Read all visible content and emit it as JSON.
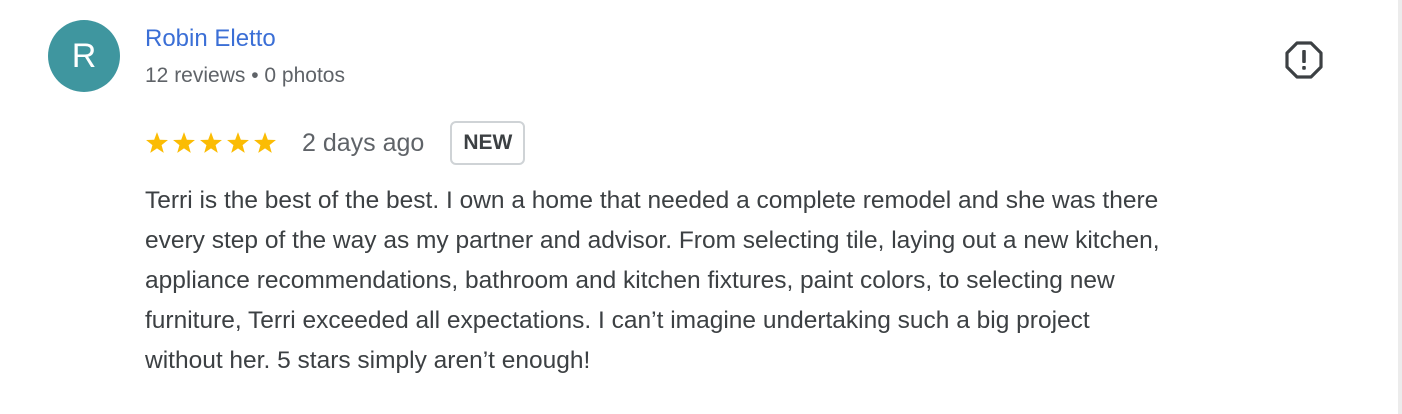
{
  "reviewer": {
    "initial": "R",
    "name": "Robin Eletto",
    "meta": "12 reviews • 0 photos",
    "avatar_color": "#3f969f"
  },
  "review": {
    "rating": 5,
    "rating_max": 5,
    "star_color": "#fbbc04",
    "date": "2 days ago",
    "badge": "NEW",
    "lines": [
      "Terri is the best of the best. I own a home that needed a complete remodel and she was there",
      "every step of the way as my partner and advisor. From selecting tile, laying out a new kitchen,",
      "appliance recommendations, bathroom and kitchen fixtures, paint colors, to selecting new",
      "furniture, Terri exceeded all expectations. I can’t imagine undertaking such a big project",
      "without her. 5 stars simply aren’t enough!"
    ]
  },
  "actions": {
    "flag_icon": "report-flag-icon"
  }
}
